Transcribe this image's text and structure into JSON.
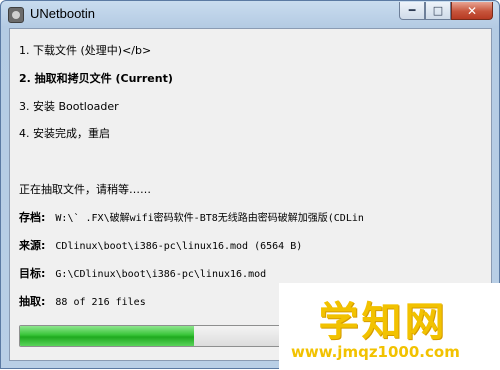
{
  "window": {
    "title": "UNetbootin"
  },
  "steps": [
    {
      "text": "1. 下载文件 (处理中)</b>"
    },
    {
      "text": "2. 抽取和拷贝文件 (Current)"
    },
    {
      "text": "3. 安装 Bootloader"
    },
    {
      "text": "4. 安装完成，重启"
    }
  ],
  "status": "正在抽取文件，请稍等……",
  "details": {
    "archive": {
      "label": "存档:",
      "value": "W:\\`                    .FX\\破解wifi密码软件-BT8无线路由密码破解加强版(CDLin"
    },
    "source": {
      "label": "来源:",
      "value": "CDlinux\\boot\\i386-pc\\linux16.mod (6564 B)"
    },
    "target": {
      "label": "目标:",
      "value": "G:\\CDlinux\\boot\\i386-pc\\linux16.mod"
    },
    "extract": {
      "label": "抽取:",
      "value": "88 of 216 files"
    }
  },
  "progress": {
    "fraction": 0.46,
    "color": "#37c437"
  },
  "watermark": {
    "main": "学知网",
    "url": "www.jmqz1000.com",
    "color": "#f2c200"
  }
}
